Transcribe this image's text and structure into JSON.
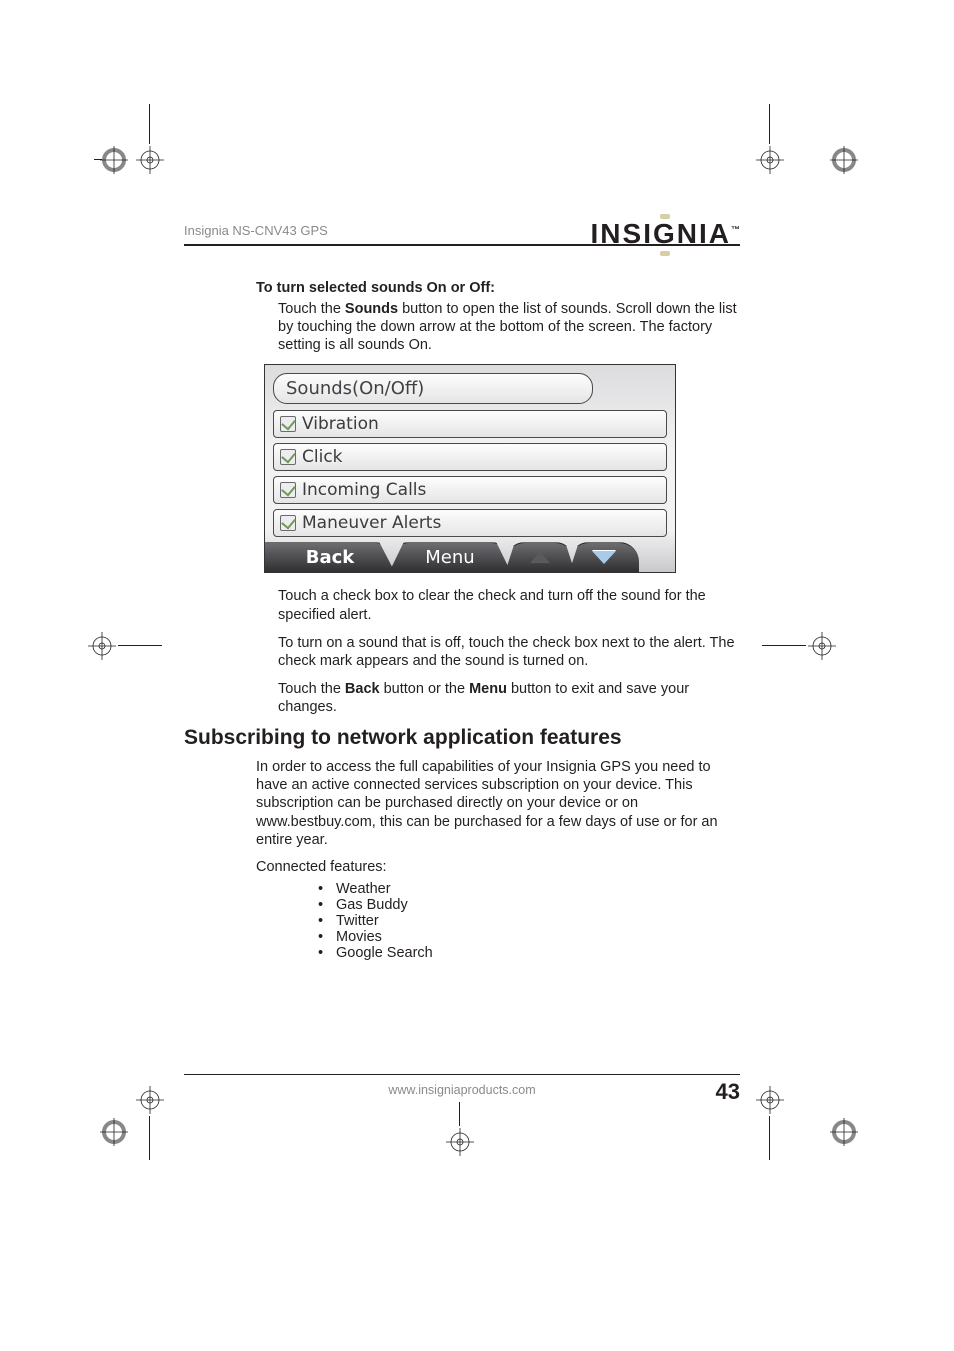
{
  "header": {
    "model": "Insignia NS-CNV43 GPS",
    "brand": "INSIGNIA",
    "brand_tm": "™"
  },
  "section1": {
    "heading": "To turn selected sounds On or Off:",
    "p1_a": "Touch the ",
    "p1_b": "Sounds",
    "p1_c": " button to open the list of sounds. Scroll down the list by touching the down arrow at the bottom of the screen. The factory setting is all sounds On."
  },
  "screenshot": {
    "title": "Sounds(On/Off)",
    "items": [
      "Vibration",
      "Click",
      "Incoming Calls",
      "Maneuver Alerts"
    ],
    "back": "Back",
    "menu": "Menu"
  },
  "after": {
    "p2": "Touch a check box to clear the check and turn off the sound for the specified alert.",
    "p3": "To turn on a sound that is off, touch the check box next to the alert. The check mark appears and the sound is turned on.",
    "p4_a": "Touch the ",
    "p4_b": "Back",
    "p4_c": " button or the ",
    "p4_d": "Menu",
    "p4_e": " button to exit and save your changes."
  },
  "section2": {
    "heading": "Subscribing to network application features",
    "p1": "In order to access the full capabilities of your Insignia GPS you need to have an active connected services subscription on your device. This subscription can be purchased directly on your device or on www.bestbuy.com, this can be purchased for a few days of use or for an entire year.",
    "features_label": "Connected features:",
    "features": [
      "Weather",
      "Gas Buddy",
      "Twitter",
      "Movies",
      "Google Search"
    ]
  },
  "footer": {
    "url": "www.insigniaproducts.com",
    "page": "43"
  }
}
